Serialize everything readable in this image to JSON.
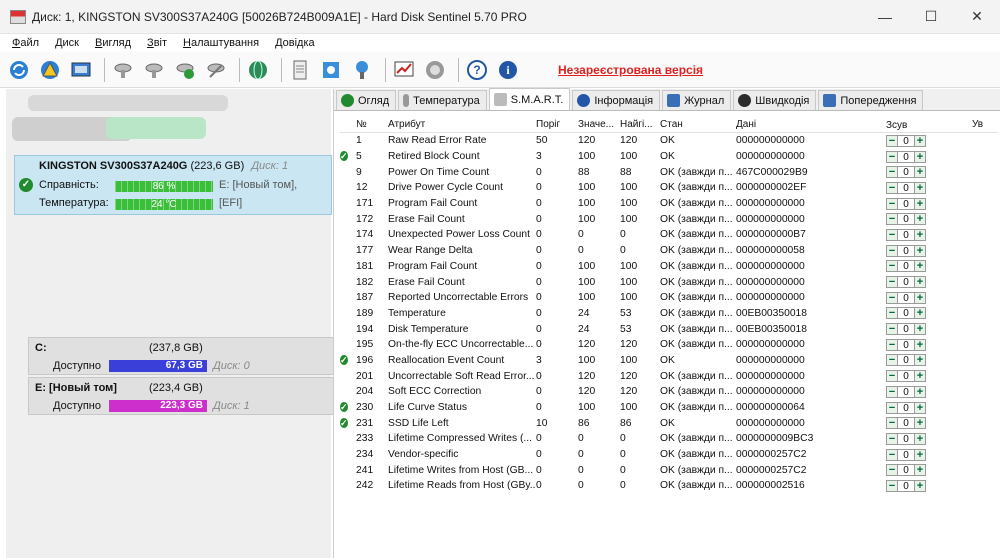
{
  "window": {
    "title": "Диск: 1, KINGSTON SV300S37A240G [50026B724B009A1E]  -  Hard Disk Sentinel 5.70 PRO",
    "min": "—",
    "max": "☐",
    "close": "✕"
  },
  "menu": [
    "Файл",
    "Диск",
    "Вигляд",
    "Звіт",
    "Налаштування",
    "Довідка"
  ],
  "toolbar": {
    "unregistered": "Незареєстрована версія",
    "icons": [
      "refresh-icon",
      "warning-icon",
      "monitor-icon",
      "disk-tool-icon",
      "disk-tool-icon",
      "disk-check-icon",
      "disk-tool-icon",
      "globe-icon",
      "document-icon",
      "settings-icon",
      "network-icon",
      "chart-icon",
      "power-icon",
      "help-icon",
      "info-icon"
    ]
  },
  "disk": {
    "name": "KINGSTON SV300S37A240G",
    "size": "(223,6 GB)",
    "index": "Диск: 1",
    "health_label": "Справність:",
    "health_value": "86 %",
    "health_fraction": 0.86,
    "temp_label": "Температура:",
    "temp_value": "24 °C",
    "volume": "E: [Новый том],",
    "boot": "[EFI]"
  },
  "partitions": [
    {
      "name": "C:",
      "size": "(237,8 GB)",
      "free_label": "Доступно",
      "free": "67,3 GB",
      "disk": "Диск: 0",
      "color": "#3b3fd9"
    },
    {
      "name": "E: [Новый том]",
      "size": "(223,4 GB)",
      "free_label": "Доступно",
      "free": "223,3 GB",
      "disk": "Диск: 1",
      "color": "#cc2fcc"
    }
  ],
  "tabs": [
    {
      "label": "Огляд",
      "icon": "check-icon"
    },
    {
      "label": "Температура",
      "icon": "thermometer-icon"
    },
    {
      "label": "S.M.A.R.T.",
      "icon": "smart-icon"
    },
    {
      "label": "Інформація",
      "icon": "info-icon"
    },
    {
      "label": "Журнал",
      "icon": "journal-icon"
    },
    {
      "label": "Швидкодія",
      "icon": "speed-icon"
    },
    {
      "label": "Попередження",
      "icon": "alert-icon"
    }
  ],
  "smart": {
    "headers": [
      "№",
      "Атрибут",
      "Поріг",
      "Значе...",
      "Найгі...",
      "Стан",
      "Дані",
      "Зсув",
      "Ув"
    ],
    "rows": [
      {
        "no": "1",
        "attr": "Raw Read Error Rate",
        "thr": "50",
        "val": "120",
        "worst": "120",
        "state": "OK",
        "data": "000000000000",
        "offset": "0",
        "ok": false
      },
      {
        "no": "5",
        "attr": "Retired Block Count",
        "thr": "3",
        "val": "100",
        "worst": "100",
        "state": "OK",
        "data": "000000000000",
        "offset": "0",
        "ok": true
      },
      {
        "no": "9",
        "attr": "Power On Time Count",
        "thr": "0",
        "val": "88",
        "worst": "88",
        "state": "OK (завжди п...",
        "data": "467C000029B9",
        "offset": "0",
        "ok": false
      },
      {
        "no": "12",
        "attr": "Drive Power Cycle Count",
        "thr": "0",
        "val": "100",
        "worst": "100",
        "state": "OK (завжди п...",
        "data": "0000000002EF",
        "offset": "0",
        "ok": false
      },
      {
        "no": "171",
        "attr": "Program Fail Count",
        "thr": "0",
        "val": "100",
        "worst": "100",
        "state": "OK (завжди п...",
        "data": "000000000000",
        "offset": "0",
        "ok": false
      },
      {
        "no": "172",
        "attr": "Erase Fail Count",
        "thr": "0",
        "val": "100",
        "worst": "100",
        "state": "OK (завжди п...",
        "data": "000000000000",
        "offset": "0",
        "ok": false
      },
      {
        "no": "174",
        "attr": "Unexpected Power Loss Count",
        "thr": "0",
        "val": "0",
        "worst": "0",
        "state": "OK (завжди п...",
        "data": "0000000000B7",
        "offset": "0",
        "ok": false
      },
      {
        "no": "177",
        "attr": "Wear Range Delta",
        "thr": "0",
        "val": "0",
        "worst": "0",
        "state": "OK (завжди п...",
        "data": "000000000058",
        "offset": "0",
        "ok": false
      },
      {
        "no": "181",
        "attr": "Program Fail Count",
        "thr": "0",
        "val": "100",
        "worst": "100",
        "state": "OK (завжди п...",
        "data": "000000000000",
        "offset": "0",
        "ok": false
      },
      {
        "no": "182",
        "attr": "Erase Fail Count",
        "thr": "0",
        "val": "100",
        "worst": "100",
        "state": "OK (завжди п...",
        "data": "000000000000",
        "offset": "0",
        "ok": false
      },
      {
        "no": "187",
        "attr": "Reported Uncorrectable Errors",
        "thr": "0",
        "val": "100",
        "worst": "100",
        "state": "OK (завжди п...",
        "data": "000000000000",
        "offset": "0",
        "ok": false
      },
      {
        "no": "189",
        "attr": "Temperature",
        "thr": "0",
        "val": "24",
        "worst": "53",
        "state": "OK (завжди п...",
        "data": "00EB00350018",
        "offset": "0",
        "ok": false
      },
      {
        "no": "194",
        "attr": "Disk Temperature",
        "thr": "0",
        "val": "24",
        "worst": "53",
        "state": "OK (завжди п...",
        "data": "00EB00350018",
        "offset": "0",
        "ok": false
      },
      {
        "no": "195",
        "attr": "On-the-fly ECC Uncorrectable...",
        "thr": "0",
        "val": "120",
        "worst": "120",
        "state": "OK (завжди п...",
        "data": "000000000000",
        "offset": "0",
        "ok": false
      },
      {
        "no": "196",
        "attr": "Reallocation Event Count",
        "thr": "3",
        "val": "100",
        "worst": "100",
        "state": "OK",
        "data": "000000000000",
        "offset": "0",
        "ok": true
      },
      {
        "no": "201",
        "attr": "Uncorrectable Soft Read Error...",
        "thr": "0",
        "val": "120",
        "worst": "120",
        "state": "OK (завжди п...",
        "data": "000000000000",
        "offset": "0",
        "ok": false
      },
      {
        "no": "204",
        "attr": "Soft ECC Correction",
        "thr": "0",
        "val": "120",
        "worst": "120",
        "state": "OK (завжди п...",
        "data": "000000000000",
        "offset": "0",
        "ok": false
      },
      {
        "no": "230",
        "attr": "Life Curve Status",
        "thr": "0",
        "val": "100",
        "worst": "100",
        "state": "OK (завжди п...",
        "data": "000000000064",
        "offset": "0",
        "ok": true
      },
      {
        "no": "231",
        "attr": "SSD Life Left",
        "thr": "10",
        "val": "86",
        "worst": "86",
        "state": "OK",
        "data": "000000000000",
        "offset": "0",
        "ok": true
      },
      {
        "no": "233",
        "attr": "Lifetime Compressed Writes (...",
        "thr": "0",
        "val": "0",
        "worst": "0",
        "state": "OK (завжди п...",
        "data": "0000000009BC3",
        "offset": "0",
        "ok": false
      },
      {
        "no": "234",
        "attr": "Vendor-specific",
        "thr": "0",
        "val": "0",
        "worst": "0",
        "state": "OK (завжди п...",
        "data": "0000000257C2",
        "offset": "0",
        "ok": false
      },
      {
        "no": "241",
        "attr": "Lifetime Writes from Host (GB...",
        "thr": "0",
        "val": "0",
        "worst": "0",
        "state": "OK (завжди п...",
        "data": "0000000257C2",
        "offset": "0",
        "ok": false
      },
      {
        "no": "242",
        "attr": "Lifetime Reads from Host (GBy...",
        "thr": "0",
        "val": "0",
        "worst": "0",
        "state": "OK (завжди п...",
        "data": "000000002516",
        "offset": "0",
        "ok": false
      }
    ]
  }
}
